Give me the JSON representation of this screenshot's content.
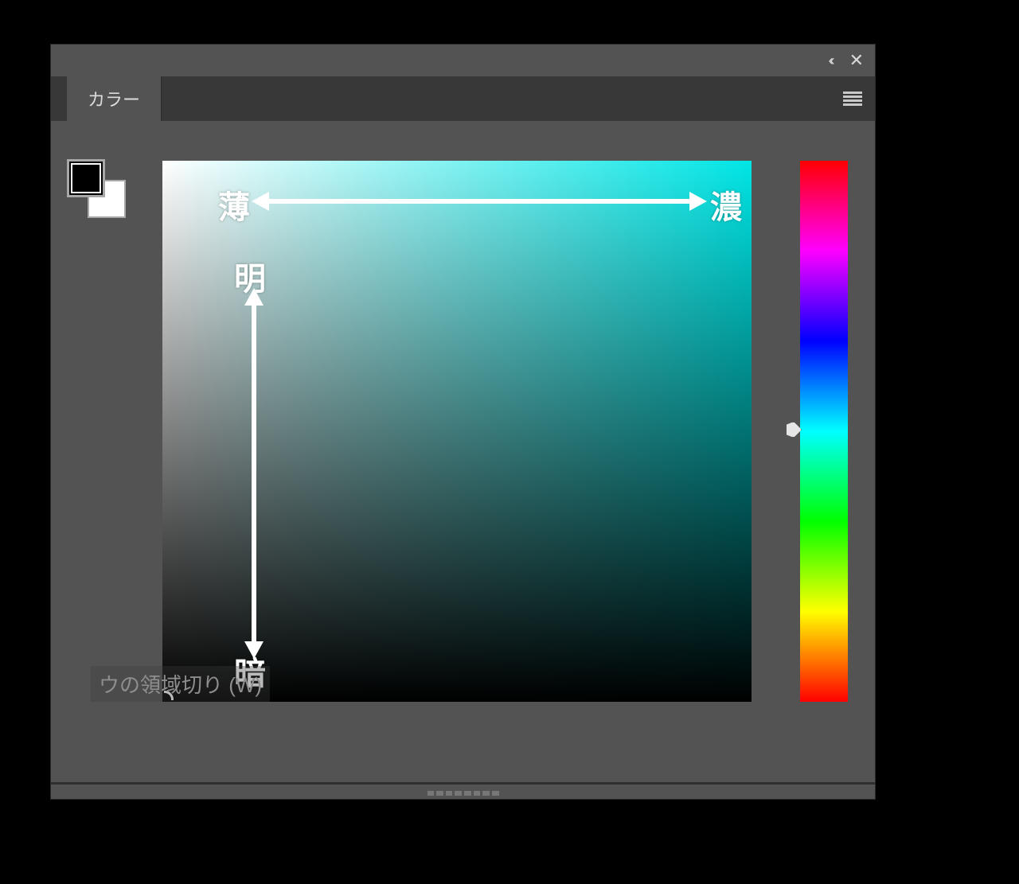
{
  "panel": {
    "tab_label": "カラー",
    "collapse_glyph": "‹‹",
    "close_glyph": "✕"
  },
  "annotations": {
    "thin": "薄",
    "thick": "濃",
    "bright": "明",
    "dark": "暗"
  },
  "overlay": {
    "partial_text": "ウの領域切り       (W)"
  },
  "colors": {
    "foreground": "#000000",
    "background": "#ffffff",
    "current_hue": "#00e5e5"
  }
}
